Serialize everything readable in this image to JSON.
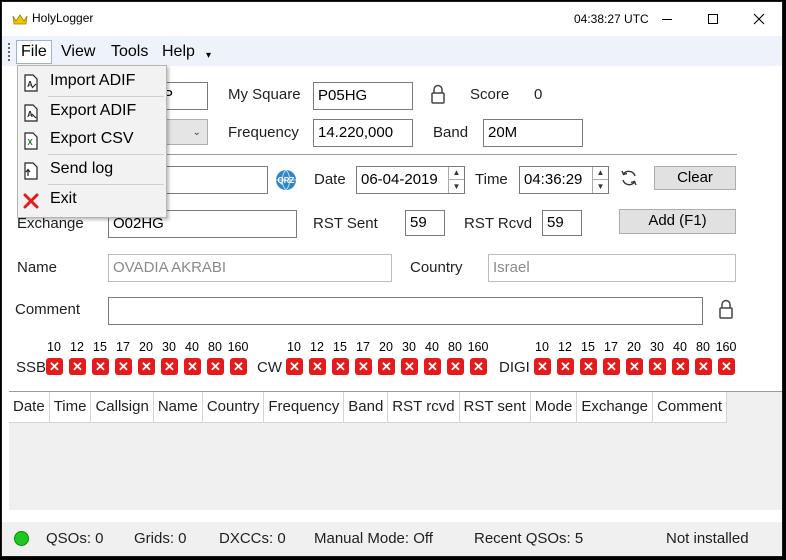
{
  "app": {
    "title": "HolyLogger",
    "clock": "04:38:27 UTC",
    "accent": "#f5c400"
  },
  "menu": {
    "file": "File",
    "view": "View",
    "tools": "Tools",
    "help": "Help",
    "overflow": "▾",
    "file_items": [
      {
        "label": "Import ADIF",
        "icon": "adif-import-icon"
      },
      {
        "label": "Export ADIF",
        "icon": "adif-export-icon"
      },
      {
        "label": "Export CSV",
        "icon": "csv-export-icon"
      },
      {
        "label": "Send log",
        "icon": "send-log-icon"
      },
      {
        "label": "Exit",
        "icon": "exit-x-icon"
      }
    ]
  },
  "form": {
    "callsign_partial": "P",
    "my_square_label": "My Square",
    "my_square_value": "P05HG",
    "score_label": "Score",
    "score_value": "0",
    "frequency_label": "Frequency",
    "frequency_value": "14.220,000",
    "band_label": "Band",
    "band_value": "20M",
    "date_label": "Date",
    "date_value": "06-04-2019",
    "time_label": "Time",
    "time_value": "04:36:29",
    "clear_label": "Clear",
    "exchange_label": "Exchange",
    "exchange_value": "O02HG",
    "rst_sent_label": "RST Sent",
    "rst_sent_value": "59",
    "rst_rcvd_label": "RST Rcvd",
    "rst_rcvd_value": "59",
    "add_label": "Add (F1)",
    "name_label": "Name",
    "name_value": "OVADIA AKRABI",
    "country_label": "Country",
    "country_value": "Israel",
    "comment_label": "Comment",
    "comment_value": ""
  },
  "bands": {
    "numbers": [
      "10",
      "12",
      "15",
      "17",
      "20",
      "30",
      "40",
      "80",
      "160"
    ],
    "modes": [
      "SSB",
      "CW",
      "DIGI"
    ],
    "status_color": "#e51b1b"
  },
  "grid": {
    "columns": [
      "Date",
      "Time",
      "Callsign",
      "Name",
      "Country",
      "Frequency",
      "Band",
      "RST rcvd",
      "RST sent",
      "Mode",
      "Exchange",
      "Comment"
    ]
  },
  "status": {
    "indicator_color": "#1ec81e",
    "qsos": "QSOs:  0",
    "grids": "Grids:  0",
    "dxccs": "DXCCs:  0",
    "manual_mode": "Manual Mode:  Off",
    "recent_qsos": "Recent QSOs:  5",
    "install_state": "Not installed"
  }
}
